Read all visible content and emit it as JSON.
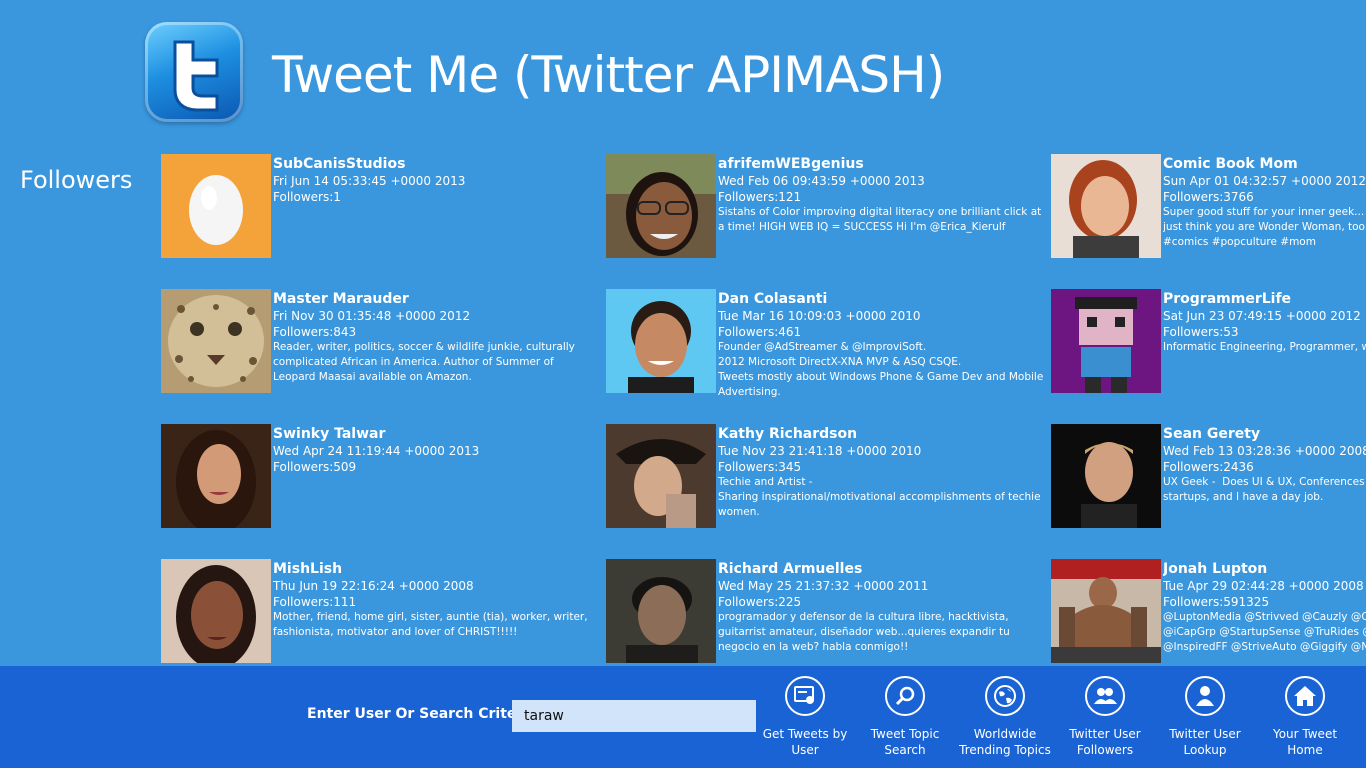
{
  "app": {
    "title": "Tweet Me (Twitter APIMASH)",
    "logo_icon": "twitter-t-icon"
  },
  "section": {
    "title": "Followers"
  },
  "followers": [
    {
      "name": "SubCanisStudios",
      "date": "Fri Jun 14 05:33:45 +0000 2013",
      "followers_label": "Followers:",
      "followers": "1",
      "description": "",
      "avatar": "default-egg"
    },
    {
      "name": "afrifemWEBgenius",
      "date": "Wed Feb 06 09:43:59 +0000 2013",
      "followers_label": "Followers:",
      "followers": "121",
      "description": "Sistahs of Color improving digital literacy one brilliant click at a time! HIGH WEB IQ = SUCCESS Hi I'm @Erica_Kierulf",
      "avatar": "woman-glasses"
    },
    {
      "name": "Comic Book Mom",
      "date": "Sun Apr 01 04:32:57 +0000 2012",
      "followers_label": "Followers:",
      "followers": "3766",
      "description": "Super good stuff for your inner geek... or just think you are Wonder Woman, too. #comics #popculture #mom",
      "avatar": "woman-red-hair"
    },
    {
      "name": "Master Marauder",
      "date": "Fri Nov 30 01:35:48 +0000 2012",
      "followers_label": "Followers:",
      "followers": "843",
      "description": "Reader, writer, politics, soccer & wildlife junkie, culturally complicated African in America. Author of Summer of Leopard Maasai available on Amazon.",
      "avatar": "leopard"
    },
    {
      "name": "Dan Colasanti",
      "date": "Tue Mar 16 10:09:03 +0000 2010",
      "followers_label": "Followers:",
      "followers": "461",
      "description": "Founder @AdStreamer & @ImproviSoft.\n2012 Microsoft DirectX-XNA MVP & ASQ CSQE.\nTweets mostly about Windows Phone & Game Dev and Mobile Advertising.",
      "avatar": "man-blue-bg"
    },
    {
      "name": "ProgrammerLife",
      "date": "Sat Jun 23 07:49:15 +0000 2012",
      "followers_label": "Followers:",
      "followers": "53",
      "description": "Informatic Engineering, Programmer, wannabe",
      "avatar": "pixel-character"
    },
    {
      "name": "Swinky Talwar",
      "date": "Wed Apr 24 11:19:44 +0000 2013",
      "followers_label": "Followers:",
      "followers": "509",
      "description": "",
      "avatar": "woman-long-hair"
    },
    {
      "name": "Kathy Richardson",
      "date": "Tue Nov 23 21:41:18 +0000 2010",
      "followers_label": "Followers:",
      "followers": "345",
      "description": "Techie and Artist -\nSharing inspirational/motivational accomplishments of techie women.",
      "avatar": "woman-hat"
    },
    {
      "name": "Sean Gerety",
      "date": "Wed Feb 13 03:28:36 +0000 2008",
      "followers_label": "Followers:",
      "followers": "2436",
      "description": "UX Geek -  Does UI & UX, Conferences (http\nstartups, and I have a day job.",
      "avatar": "man-dark-bg"
    },
    {
      "name": "MishLish",
      "date": "Thu Jun 19 22:16:24 +0000 2008",
      "followers_label": "Followers:",
      "followers": "111",
      "description": "Mother, friend, home girl, sister, auntie (tia), worker, writer, fashionista, motivator and lover of CHRIST!!!!!",
      "avatar": "woman-portrait"
    },
    {
      "name": "Richard Armuelles",
      "date": "Wed May 25 21:37:32 +0000 2011",
      "followers_label": "Followers:",
      "followers": "225",
      "description": "programador y defensor de la cultura libre, hacktivista, guitarrist amateur, diseñador web...quieres expandir tu negocio en la web? habla conmigo!!",
      "avatar": "man-dim"
    },
    {
      "name": "Jonah Lupton",
      "date": "Tue Apr 29 02:44:28 +0000 2008",
      "followers_label": "Followers:",
      "followers": "591325",
      "description": "@LuptonMedia @Strivved @Cauzly @Gree\n@iCapGrp @StartupSense @TruRides @Lu\n@InspiredFF @StriveAuto @Giggify @Nut",
      "avatar": "man-gym"
    }
  ],
  "bottom_bar": {
    "search_label": "Enter User Or Search Criteria:",
    "search_value": "taraw",
    "buttons": [
      {
        "label": "Get Tweets by User",
        "icon": "tweets-by-user-icon"
      },
      {
        "label": "Tweet Topic Search",
        "icon": "search-icon"
      },
      {
        "label": "Worldwide Trending Topics",
        "icon": "globe-icon"
      },
      {
        "label": "Twitter User Followers",
        "icon": "followers-icon"
      },
      {
        "label": "Twitter User Lookup",
        "icon": "user-lookup-icon"
      },
      {
        "label": "Your Tweet Home",
        "icon": "home-icon"
      }
    ]
  },
  "colors": {
    "background": "#3a97de",
    "bottom_bar": "#1a63d4",
    "search_box": "#d2e4f9",
    "egg_avatar_bg": "#f4a23a"
  }
}
